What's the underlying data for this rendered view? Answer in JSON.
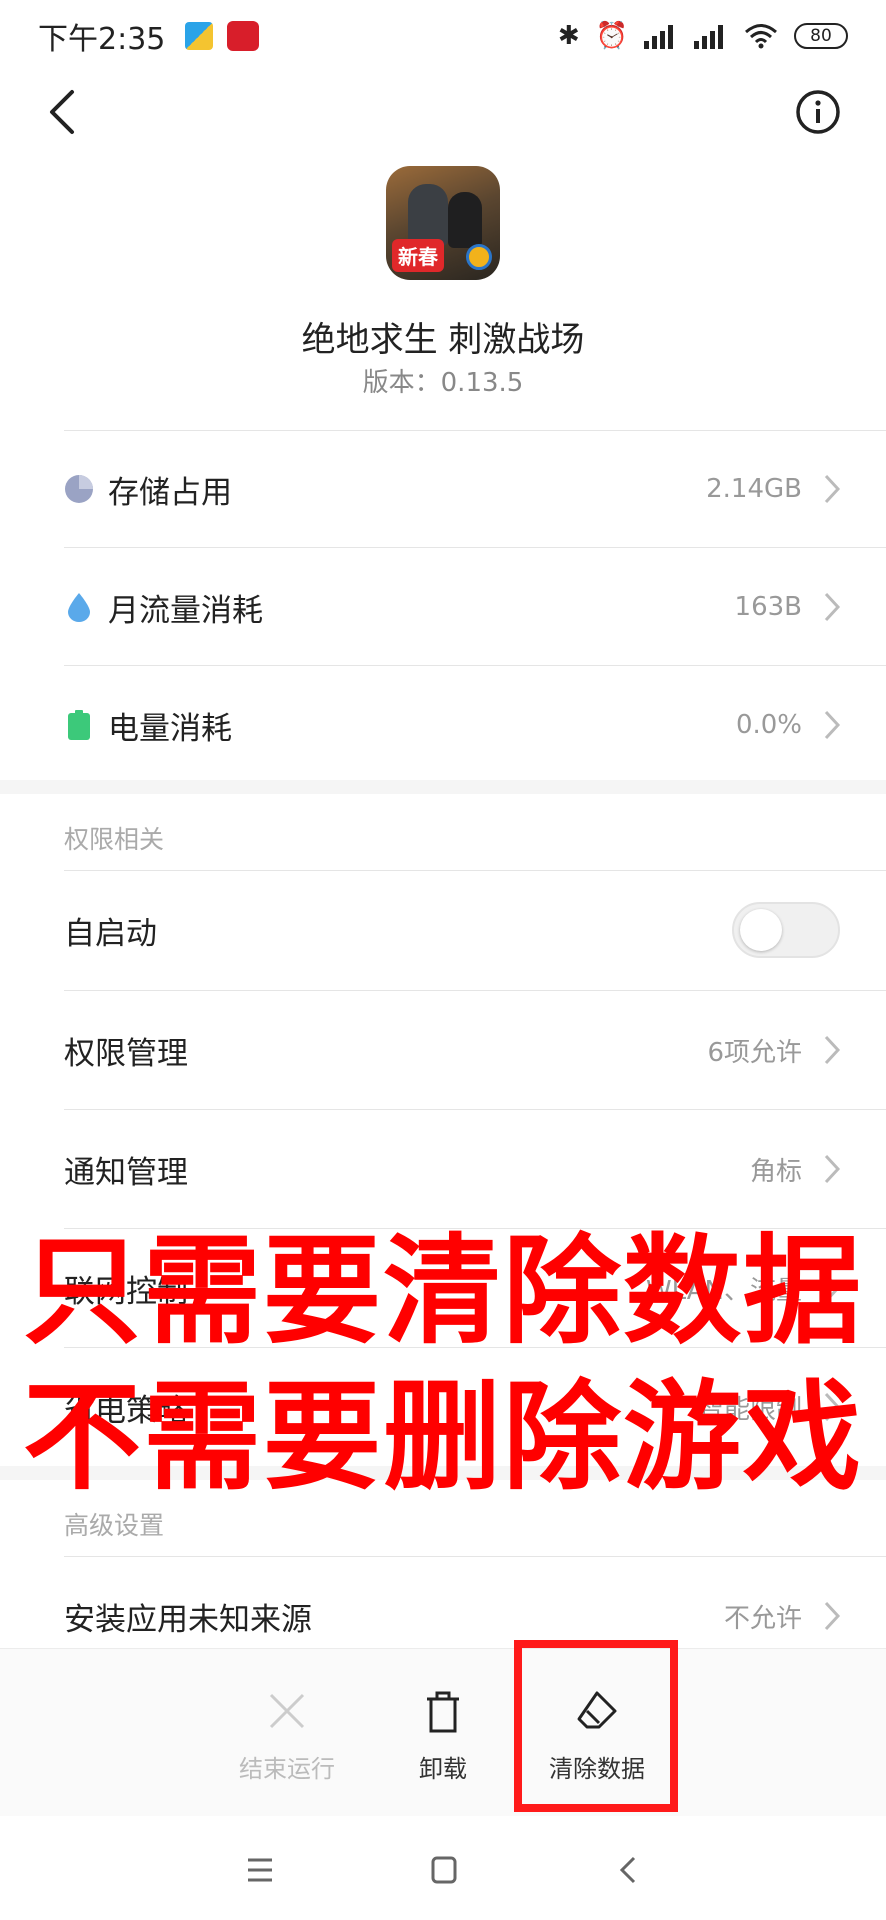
{
  "status": {
    "time": "下午2:35",
    "battery": "80"
  },
  "app": {
    "name": "绝地求生 刺激战场",
    "version": "版本：0.13.5",
    "icon_badge": "新春"
  },
  "usage": [
    {
      "label": "存储占用",
      "value": "2.14GB",
      "icon": "pie-chart-icon",
      "icon_color": "#9aa3c4"
    },
    {
      "label": "月流量消耗",
      "value": "163B",
      "icon": "water-drop-icon",
      "icon_color": "#5aa9ea"
    },
    {
      "label": "电量消耗",
      "value": "0.0%",
      "icon": "battery-icon",
      "icon_color": "#3cc97a"
    }
  ],
  "permissions": {
    "title": "权限相关",
    "autostart_label": "自启动",
    "autostart_on": false,
    "rows": [
      {
        "label": "权限管理",
        "value": "6项允许"
      },
      {
        "label": "通知管理",
        "value": "角标"
      },
      {
        "label": "联网控制",
        "value": "WLAN、流量"
      },
      {
        "label": "省电策略",
        "value": "智能限制"
      }
    ]
  },
  "advanced": {
    "title": "高级设置",
    "rows": [
      {
        "label": "安装应用未知来源",
        "value": "不允许"
      }
    ]
  },
  "overlay": {
    "line1": "只需要清除数据",
    "line2": "不需要删除游戏",
    "color": "#ff0000"
  },
  "actions": {
    "force_stop": "结束运行",
    "uninstall": "卸载",
    "clear_data": "清除数据"
  }
}
